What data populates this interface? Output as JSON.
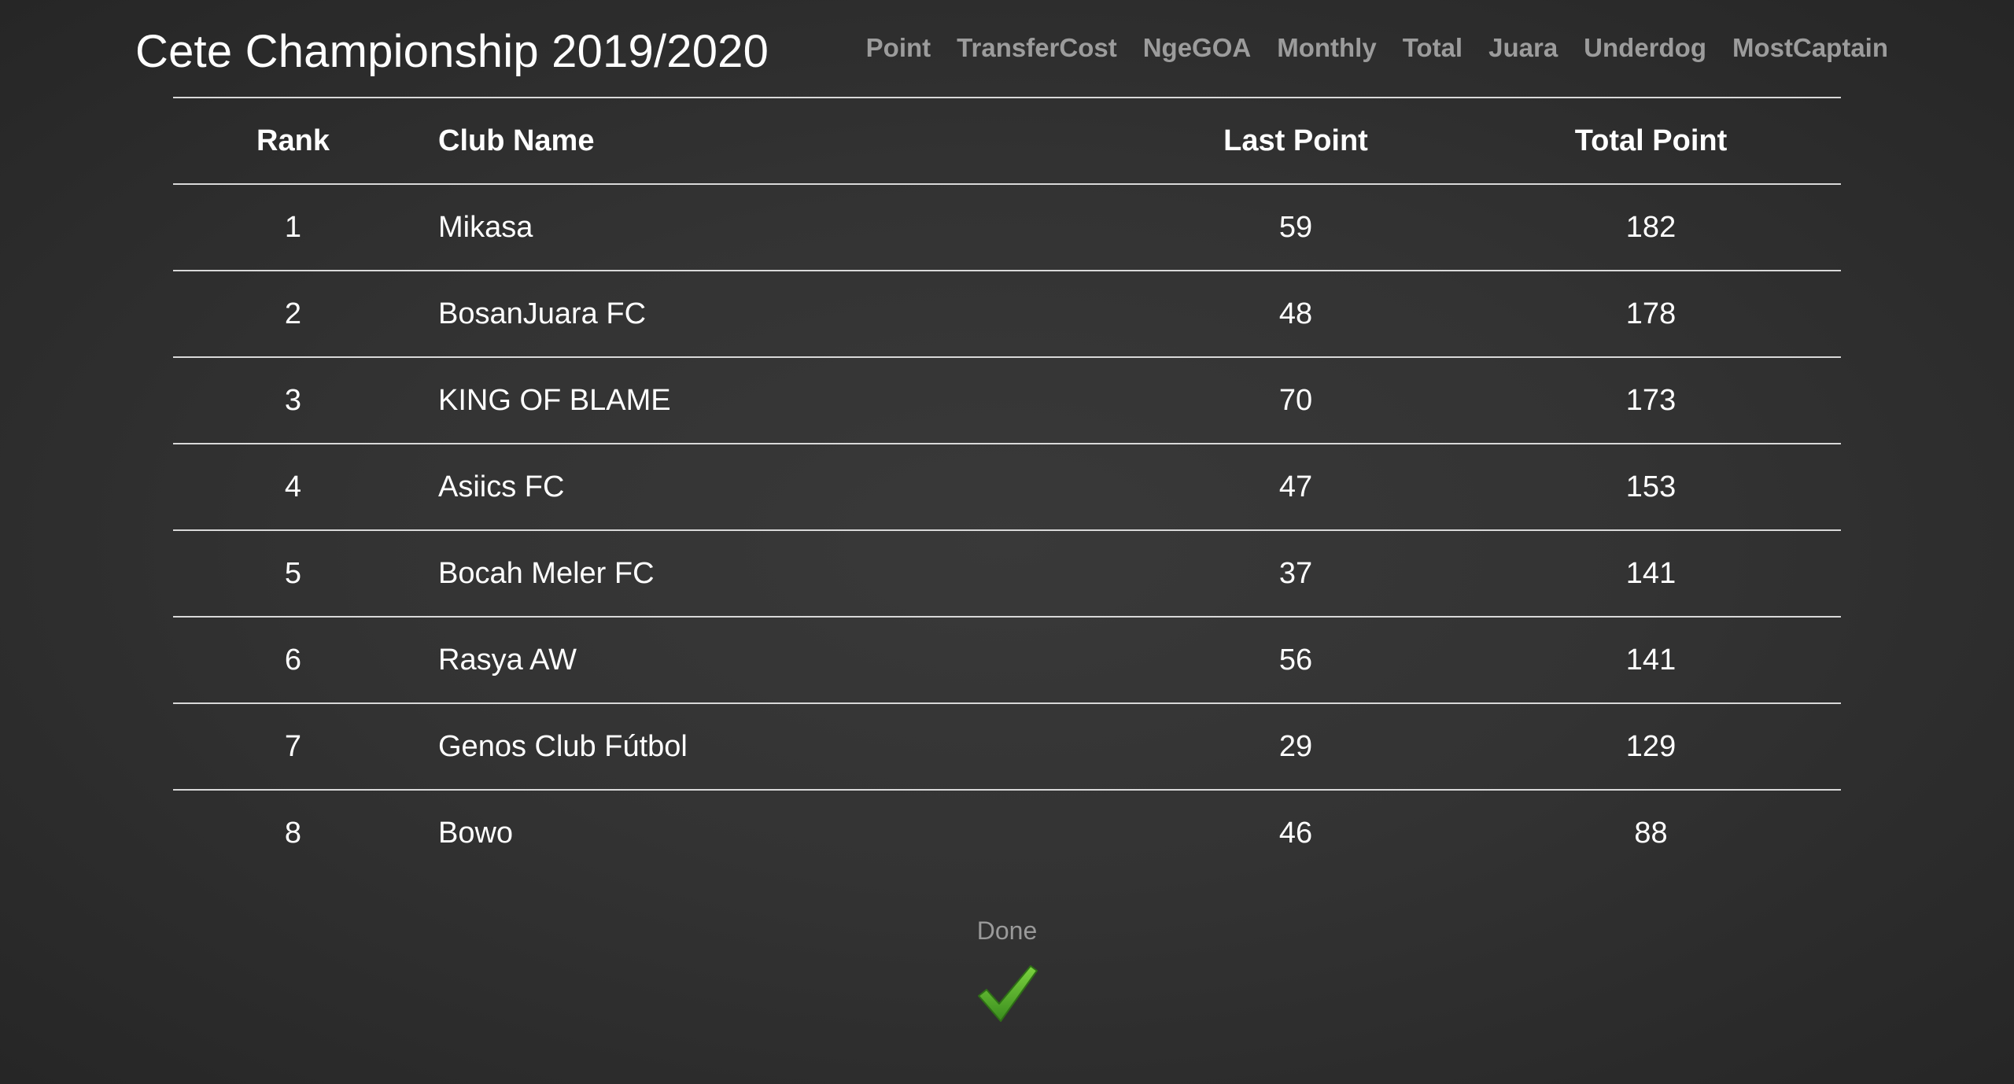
{
  "header": {
    "title": "Cete Championship 2019/2020"
  },
  "nav": {
    "items": [
      {
        "label": "Point"
      },
      {
        "label": "TransferCost"
      },
      {
        "label": "NgeGOA"
      },
      {
        "label": "Monthly"
      },
      {
        "label": "Total"
      },
      {
        "label": "Juara"
      },
      {
        "label": "Underdog"
      },
      {
        "label": "MostCaptain"
      }
    ]
  },
  "table": {
    "headers": {
      "rank": "Rank",
      "club": "Club Name",
      "last": "Last Point",
      "total": "Total Point"
    },
    "rows": [
      {
        "rank": "1",
        "club": "Mikasa",
        "last": "59",
        "total": "182"
      },
      {
        "rank": "2",
        "club": "BosanJuara FC",
        "last": "48",
        "total": "178"
      },
      {
        "rank": "3",
        "club": "KING OF BLAME",
        "last": "70",
        "total": "173"
      },
      {
        "rank": "4",
        "club": "Asiics FC",
        "last": "47",
        "total": "153"
      },
      {
        "rank": "5",
        "club": "Bocah Meler FC",
        "last": "37",
        "total": "141"
      },
      {
        "rank": "6",
        "club": "Rasya AW",
        "last": "56",
        "total": "141"
      },
      {
        "rank": "7",
        "club": "Genos Club Fútbol",
        "last": "29",
        "total": "129"
      },
      {
        "rank": "8",
        "club": "Bowo",
        "last": "46",
        "total": "88"
      }
    ]
  },
  "footer": {
    "done_label": "Done",
    "done_icon": "checkmark-icon"
  },
  "colors": {
    "background": "#333333",
    "nav_text": "#9c9c9c",
    "check_green": "#4fa52a"
  }
}
